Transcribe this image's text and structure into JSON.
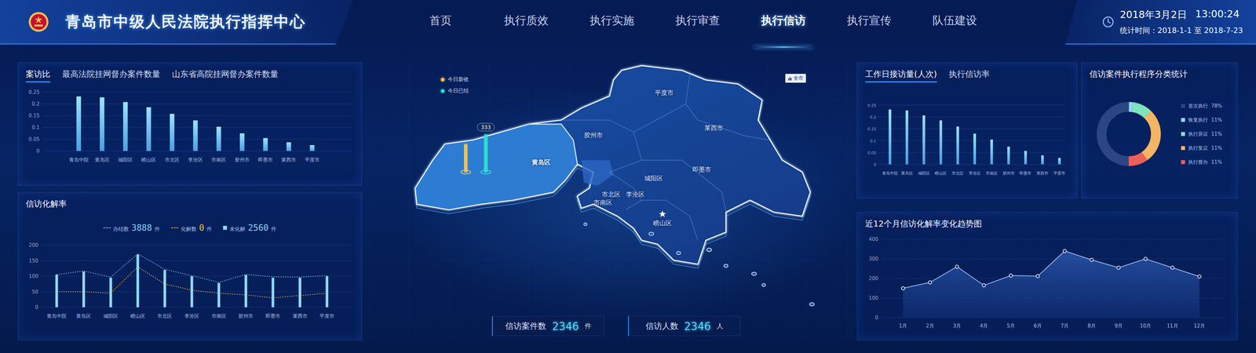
{
  "header": {
    "title": "青岛市中级人民法院执行指挥中心",
    "nav": [
      {
        "label": "首页",
        "selected": false
      },
      {
        "label": "执行质效",
        "selected": false
      },
      {
        "label": "执行实施",
        "selected": false
      },
      {
        "label": "执行审查",
        "selected": false
      },
      {
        "label": "执行信访",
        "selected": true
      },
      {
        "label": "执行宣传",
        "selected": false
      },
      {
        "label": "队伍建设",
        "selected": false
      }
    ],
    "date": "2018年3月2日",
    "time": "13:00:24",
    "stat_period": "统计时间：2018-1-1 至 2018-7-23"
  },
  "case_ratio_panel": {
    "tabs": [
      {
        "label": "案访比",
        "selected": true
      },
      {
        "label": "最高法院挂网督办案件数量",
        "selected": false
      },
      {
        "label": "山东省高院挂网督办案件数量",
        "selected": false
      }
    ],
    "chart": {
      "y_ticks": [
        "0.25",
        "0.2",
        "0.15",
        "0.1",
        "0.05",
        "0"
      ],
      "categories": [
        "青岛中院",
        "黄岛区",
        "城阳区",
        "崂山区",
        "市北区",
        "李沧区",
        "市南区",
        "胶州市",
        "即墨市",
        "莱西市",
        "平度市"
      ],
      "values": [
        0.232,
        0.228,
        0.208,
        0.186,
        0.158,
        0.13,
        0.103,
        0.075,
        0.055,
        0.037,
        0.025
      ]
    }
  },
  "resolution_panel": {
    "title": "信访化解率",
    "legend": [
      {
        "label": "办结数",
        "value": "3888",
        "unit": "件",
        "kind": "line",
        "color": "#7fd6ff"
      },
      {
        "label": "化解数",
        "value": "0",
        "unit": "件",
        "kind": "line",
        "color": "#f5c342"
      },
      {
        "label": "未化解",
        "value": "2560",
        "unit": "件",
        "kind": "bar",
        "color": "#8fd9f7"
      }
    ],
    "chart": {
      "y_ticks": [
        "200",
        "150",
        "100",
        "50",
        "0"
      ],
      "categories": [
        "青岛中院",
        "黄岛区",
        "城阳区",
        "崂山区",
        "市北区",
        "李沧区",
        "市南区",
        "胶州市",
        "即墨市",
        "莱西市",
        "平度市"
      ],
      "completed": [
        105,
        117,
        97,
        172,
        122,
        102,
        80,
        106,
        98,
        97,
        102
      ],
      "resolved": [
        50,
        50,
        45,
        130,
        75,
        55,
        45,
        40,
        30,
        38,
        45
      ],
      "unresolved": [
        105,
        115,
        95,
        170,
        120,
        100,
        78,
        104,
        95,
        95,
        100
      ]
    }
  },
  "map": {
    "scope_button": "全市",
    "legend": [
      {
        "label": "今日新收",
        "color": "#f5c342"
      },
      {
        "label": "今日已结",
        "color": "#2fe0d0"
      }
    ],
    "pins": [
      {
        "level": 0.74,
        "color": "#f5c342",
        "badge": null
      },
      {
        "level": 1,
        "color": "#2fe0d0",
        "badge": "333"
      }
    ],
    "regions": [
      {
        "name": "平度市",
        "selected": false
      },
      {
        "name": "莱西市",
        "selected": false
      },
      {
        "name": "胶州市",
        "selected": false
      },
      {
        "name": "黄岛区",
        "selected": true
      },
      {
        "name": "即墨市",
        "selected": false
      },
      {
        "name": "城阳区",
        "selected": false
      },
      {
        "name": "市北区",
        "selected": false
      },
      {
        "name": "李沧区",
        "selected": false
      },
      {
        "name": "市南区",
        "selected": false
      },
      {
        "name": "崂山区",
        "selected": false
      }
    ],
    "stats": [
      {
        "label": "信访案件数",
        "value": "2346",
        "unit": "件"
      },
      {
        "label": "信访人数",
        "value": "2346",
        "unit": "人"
      }
    ]
  },
  "visits_panel": {
    "tabs": [
      {
        "label": "工作日接访量(人次)",
        "selected": true
      },
      {
        "label": "执行信访率",
        "selected": false
      }
    ],
    "chart": {
      "y_ticks": [
        "0.25",
        "0.2",
        "0.15",
        "0.1",
        "0.05",
        "0"
      ],
      "categories": [
        "青岛中院",
        "黄岛区",
        "城阳区",
        "崂山区",
        "市北区",
        "李沧区",
        "市南区",
        "胶州市",
        "即墨市",
        "莱西市",
        "平度市"
      ],
      "values": [
        0.232,
        0.228,
        0.207,
        0.186,
        0.16,
        0.13,
        0.105,
        0.075,
        0.057,
        0.038,
        0.027
      ]
    }
  },
  "category_panel": {
    "title": "信访案件执行程序分类统计",
    "segments": [
      {
        "label": "首次执行",
        "percent": "78%",
        "value": 50,
        "color": "#2b4585"
      },
      {
        "label": "恢复执行",
        "percent": "11%",
        "value": 2,
        "color": "#8fd8f0"
      },
      {
        "label": "执行异议",
        "percent": "11%",
        "value": 10,
        "color": "#7fe3bd"
      },
      {
        "label": "执行复议",
        "percent": "11%",
        "value": 28,
        "color": "#f5b461"
      },
      {
        "label": "执行督办",
        "percent": "11%",
        "value": 10,
        "color": "#ef5f5a"
      }
    ]
  },
  "trend_panel": {
    "title": "近12个月信访化解率变化趋势图",
    "chart": {
      "y_ticks": [
        "400",
        "300",
        "200",
        "100",
        "0"
      ],
      "categories": [
        "1月",
        "2月",
        "3月",
        "4月",
        "5月",
        "6月",
        "7月",
        "8月",
        "9月",
        "10月",
        "11月",
        "12月"
      ],
      "values": [
        150,
        180,
        260,
        165,
        215,
        212,
        340,
        295,
        255,
        300,
        255,
        210
      ]
    }
  }
}
